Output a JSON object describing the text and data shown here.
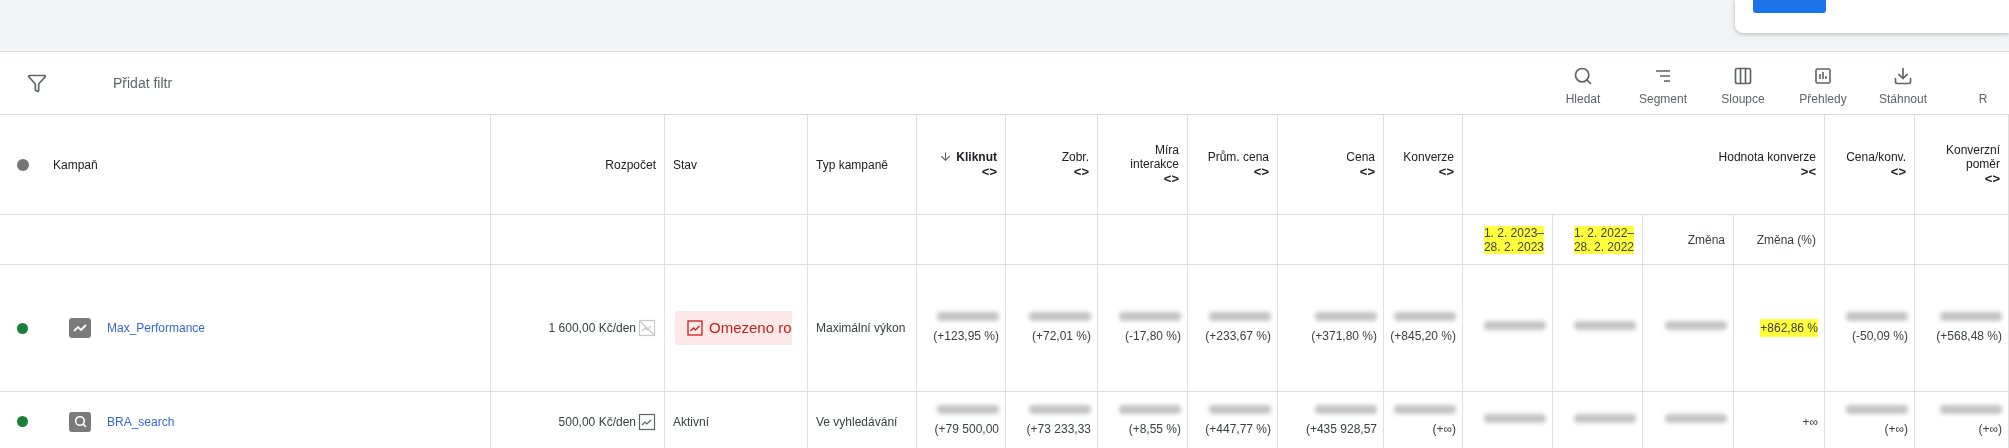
{
  "popup": {
    "button": {
      "kind": "primary"
    }
  },
  "toolbar": {
    "filter": {
      "label": "Přidat filtr"
    },
    "tools": [
      {
        "kind": "search",
        "label": "Hledat"
      },
      {
        "kind": "segment",
        "label": "Segment"
      },
      {
        "kind": "columns",
        "label": "Sloupce"
      },
      {
        "kind": "reports",
        "label": "Přehledy"
      },
      {
        "kind": "download",
        "label": "Stáhnout"
      },
      {
        "kind": "none",
        "label": "R"
      }
    ]
  },
  "table": {
    "column_group": {
      "label": "Hodnota konverze",
      "toggle": "><"
    },
    "columns": [
      {
        "kind": "main",
        "label": "Kampaň"
      },
      {
        "kind": "main",
        "label": "Rozpočet"
      },
      {
        "kind": "main",
        "label": "Stav"
      },
      {
        "kind": "main",
        "label": "Typ kampaně"
      },
      {
        "kind": "main",
        "label": "Kliknut",
        "sorted": true,
        "toggle": "<>"
      },
      {
        "kind": "main",
        "label": "Zobr.",
        "toggle": "<>"
      },
      {
        "kind": "main",
        "label": "Míra interakce",
        "toggle": "<>"
      },
      {
        "kind": "main",
        "label": "Prům. cena",
        "toggle": "<>"
      },
      {
        "kind": "main",
        "label": "Cena",
        "toggle": "<>"
      },
      {
        "kind": "main",
        "label": "Konverze",
        "toggle": "<>"
      },
      {
        "kind": "sub",
        "lines": [
          "1. 2. 2023–",
          "28. 2. 2023"
        ],
        "highlighted": true
      },
      {
        "kind": "sub",
        "lines": [
          "1. 2. 2022–",
          "28. 2. 2022"
        ],
        "highlighted": true
      },
      {
        "kind": "sub",
        "lines": [
          "Změna"
        ],
        "highlighted": false
      },
      {
        "kind": "sub",
        "lines": [
          "Změna (%)"
        ],
        "highlighted": false
      },
      {
        "kind": "main",
        "label": "Cena/konv.",
        "toggle": "<>"
      },
      {
        "kind": "main",
        "label": "Konverzní poměr",
        "toggle": "<>"
      }
    ],
    "rows": [
      {
        "color": "#188038",
        "cells": [
          {
            "kind": "performance",
            "text": "Max_Performance"
          },
          {
            "kind": "nodata",
            "text": "1 600,00 Kč/den"
          },
          {
            "kind": "chip",
            "text": "Omezeno ro"
          },
          {
            "kind": "text",
            "text": "Maximální výkon"
          },
          {
            "kind": "metric",
            "value": "(+123,95 %)",
            "redacted": true
          },
          {
            "kind": "metric",
            "value": "(+72,01 %)",
            "redacted": true
          },
          {
            "kind": "metric",
            "value": "(-17,80 %)",
            "redacted": true
          },
          {
            "kind": "metric",
            "value": "(+233,67 %)",
            "redacted": true
          },
          {
            "kind": "metric",
            "value": "(+371,80 %)",
            "redacted": true
          },
          {
            "kind": "metric",
            "value": "(+845,20 %)",
            "redacted": true
          },
          {
            "kind": "metric",
            "redacted": true
          },
          {
            "kind": "metric",
            "redacted": true
          },
          {
            "kind": "metric",
            "redacted": true
          },
          {
            "kind": "metric",
            "value": "+862,86 %",
            "redacted": false,
            "highlighted": true
          },
          {
            "kind": "metric",
            "value": "(-50,09 %)",
            "redacted": true
          },
          {
            "kind": "metric",
            "value": "(+568,48 %)",
            "redacted": true
          }
        ]
      },
      {
        "color": "#188038",
        "cells": [
          {
            "kind": "search",
            "text": "BRA_search"
          },
          {
            "kind": "budget",
            "text": "500,00 Kč/den"
          },
          {
            "kind": "text",
            "text": "Aktivní"
          },
          {
            "kind": "text",
            "text": "Ve vyhledávání"
          },
          {
            "kind": "metric",
            "value": "(+79 500,00",
            "redacted": true
          },
          {
            "kind": "metric",
            "value": "(+73 233,33",
            "redacted": true
          },
          {
            "kind": "metric",
            "value": "(+8,55 %)",
            "redacted": true
          },
          {
            "kind": "metric",
            "value": "(+447,77 %)",
            "redacted": true
          },
          {
            "kind": "metric",
            "value": "(+435 928,57",
            "redacted": true
          },
          {
            "kind": "metric",
            "value": "(+∞)",
            "redacted": true
          },
          {
            "kind": "metric",
            "redacted": true
          },
          {
            "kind": "metric",
            "redacted": true
          },
          {
            "kind": "metric",
            "redacted": true
          },
          {
            "kind": "metric",
            "value": "+∞",
            "redacted": false,
            "highlighted": false
          },
          {
            "kind": "metric",
            "value": "(+∞)",
            "redacted": true
          },
          {
            "kind": "metric",
            "value": "(+∞)",
            "redacted": true
          }
        ]
      }
    ]
  }
}
